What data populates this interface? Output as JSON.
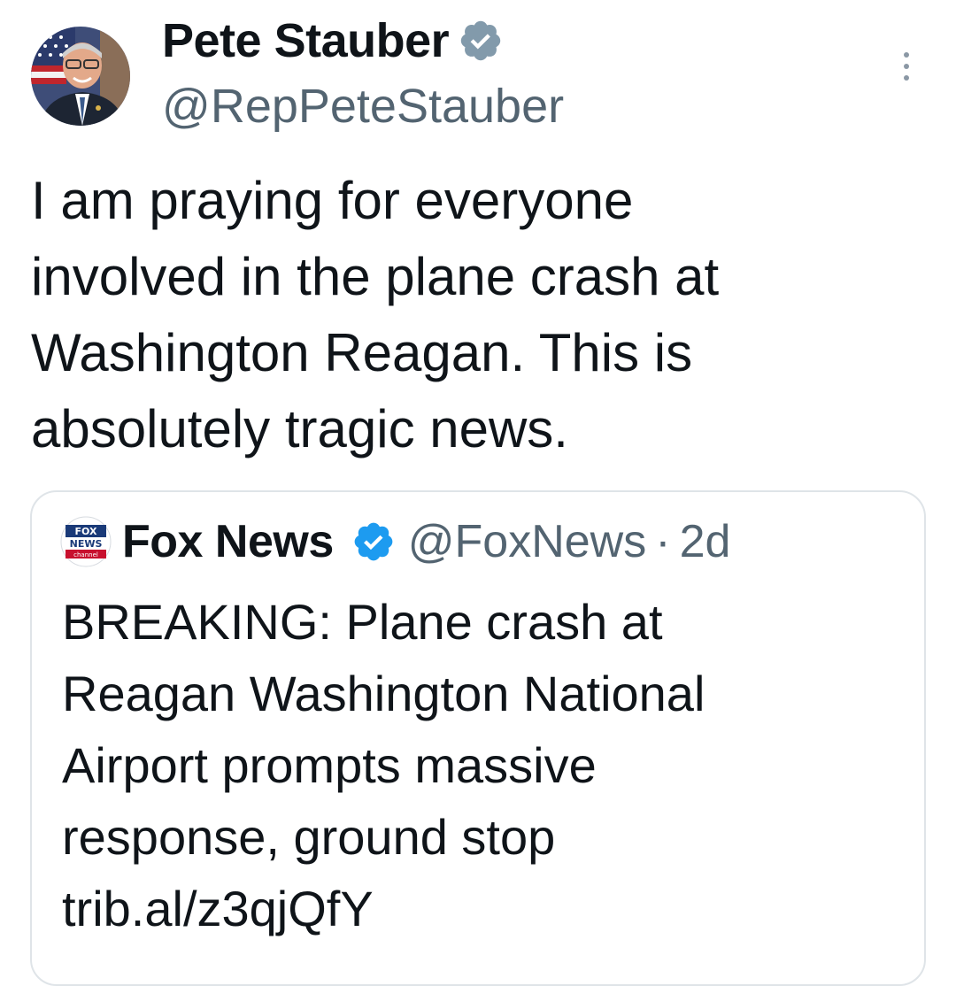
{
  "author": {
    "display_name": "Pete Stauber",
    "handle": "@RepPeteStauber",
    "verified_badge": "grey-verified-icon",
    "avatar_icon": "avatar"
  },
  "tweet": {
    "text": "I am praying for everyone\ninvolved in the plane crash at\nWashington Reagan. This is\nabsolutely tragic news."
  },
  "quoted_tweet": {
    "logo_text": {
      "line1": "FOX",
      "line2": "NEWS",
      "line3": "channel"
    },
    "display_name": "Fox News",
    "verified_badge": "blue-verified-icon",
    "handle": "@FoxNews",
    "separator": "·",
    "time": "2d",
    "text": "BREAKING: Plane crash at\nReagan Washington National\nAirport prompts massive\nresponse, ground stop\ntrib.al/z3qjQfY"
  },
  "colors": {
    "text": "#0f1419",
    "secondary": "#536471",
    "verified_blue": "#1d9bf0",
    "verified_grey": "#829aab",
    "border": "#dfe4e8"
  }
}
